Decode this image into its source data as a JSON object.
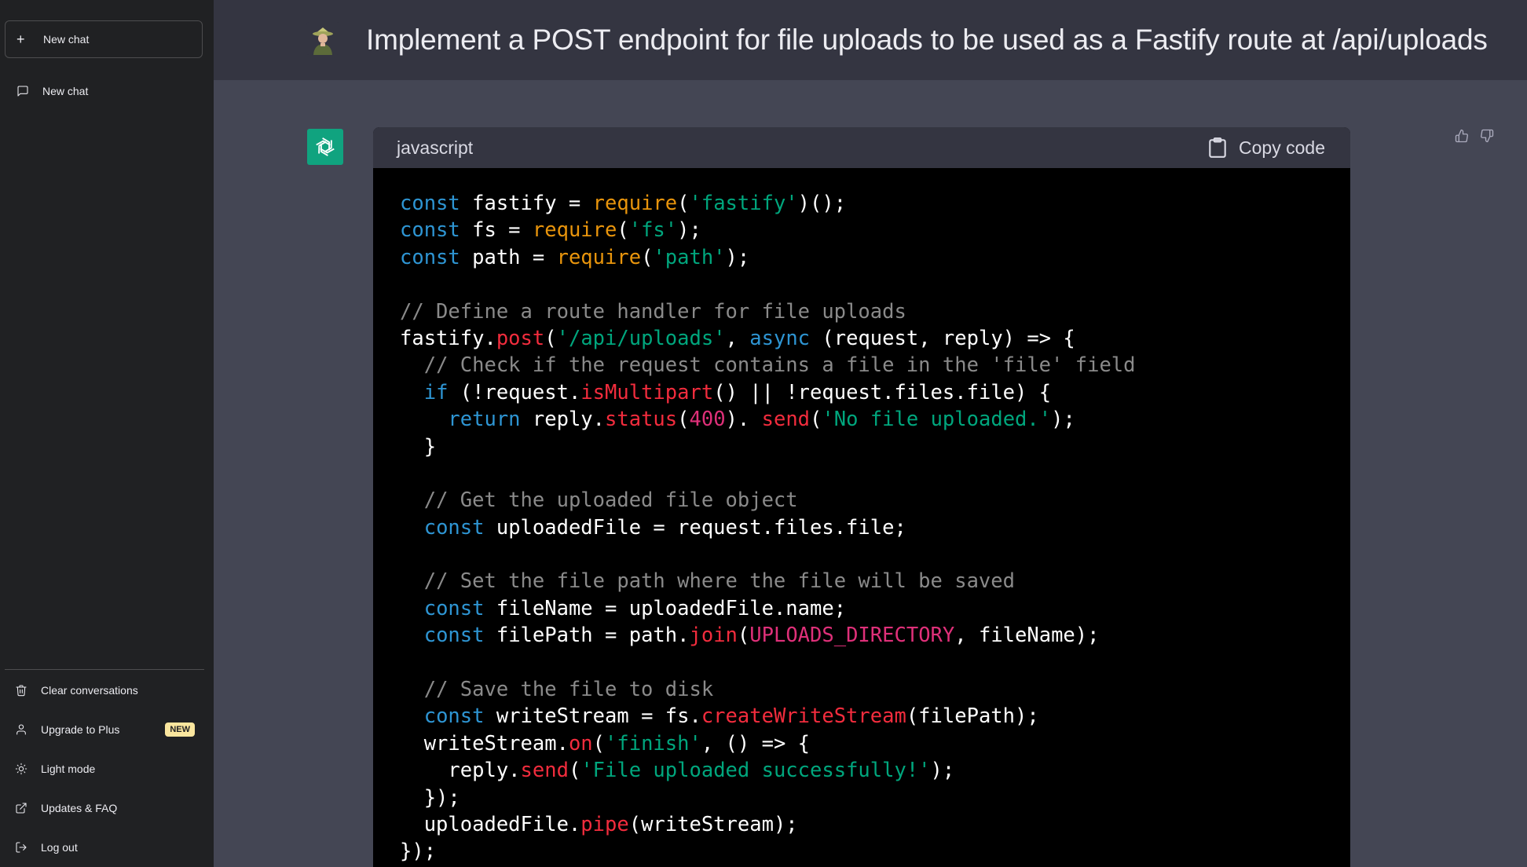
{
  "sidebar": {
    "new_chat_button": "New chat",
    "history": [
      {
        "label": "New chat"
      }
    ],
    "bottom_menu": [
      {
        "label": "Clear conversations",
        "icon": "trash-icon"
      },
      {
        "label": "Upgrade to Plus",
        "icon": "user-icon",
        "badge": "NEW"
      },
      {
        "label": "Light mode",
        "icon": "sun-icon"
      },
      {
        "label": "Updates & FAQ",
        "icon": "external-link-icon"
      },
      {
        "label": "Log out",
        "icon": "logout-icon"
      }
    ]
  },
  "conversation": {
    "user_prompt": "Implement a POST endpoint for file uploads to be used as a Fastify route at /api/uploads",
    "code_block": {
      "language": "javascript",
      "copy_label": "Copy code",
      "lines": [
        [
          [
            "kw",
            "const"
          ],
          [
            "pl",
            " fastify = "
          ],
          [
            "req",
            "require"
          ],
          [
            "pl",
            "("
          ],
          [
            "str",
            "'fastify'"
          ],
          [
            "pl",
            ")();"
          ]
        ],
        [
          [
            "kw",
            "const"
          ],
          [
            "pl",
            " fs = "
          ],
          [
            "req",
            "require"
          ],
          [
            "pl",
            "("
          ],
          [
            "str",
            "'fs'"
          ],
          [
            "pl",
            ");"
          ]
        ],
        [
          [
            "kw",
            "const"
          ],
          [
            "pl",
            " path = "
          ],
          [
            "req",
            "require"
          ],
          [
            "pl",
            "("
          ],
          [
            "str",
            "'path'"
          ],
          [
            "pl",
            ");"
          ]
        ],
        [],
        [
          [
            "cm",
            "// Define a route handler for file uploads"
          ]
        ],
        [
          [
            "pl",
            "fastify."
          ],
          [
            "fn",
            "post"
          ],
          [
            "pl",
            "("
          ],
          [
            "str",
            "'/api/uploads'"
          ],
          [
            "pl",
            ", "
          ],
          [
            "kw",
            "async"
          ],
          [
            "pl",
            " (request, reply) => {"
          ]
        ],
        [
          [
            "pl",
            "  "
          ],
          [
            "cm",
            "// Check if the request contains a file in the 'file' field"
          ]
        ],
        [
          [
            "pl",
            "  "
          ],
          [
            "kw",
            "if"
          ],
          [
            "pl",
            " (!request."
          ],
          [
            "fn",
            "isMultipart"
          ],
          [
            "pl",
            "() || !request.files.file) {"
          ]
        ],
        [
          [
            "pl",
            "    "
          ],
          [
            "kw",
            "return"
          ],
          [
            "pl",
            " reply."
          ],
          [
            "fn",
            "status"
          ],
          [
            "pl",
            "("
          ],
          [
            "num",
            "400"
          ],
          [
            "pl",
            "). "
          ],
          [
            "fn",
            "send"
          ],
          [
            "pl",
            "("
          ],
          [
            "str",
            "'No file uploaded.'"
          ],
          [
            "pl",
            ");"
          ]
        ],
        [
          [
            "pl",
            "  }"
          ]
        ],
        [],
        [
          [
            "pl",
            "  "
          ],
          [
            "cm",
            "// Get the uploaded file object"
          ]
        ],
        [
          [
            "pl",
            "  "
          ],
          [
            "kw",
            "const"
          ],
          [
            "pl",
            " uploadedFile = request.files.file;"
          ]
        ],
        [],
        [
          [
            "pl",
            "  "
          ],
          [
            "cm",
            "// Set the file path where the file will be saved"
          ]
        ],
        [
          [
            "pl",
            "  "
          ],
          [
            "kw",
            "const"
          ],
          [
            "pl",
            " fileName = uploadedFile.name;"
          ]
        ],
        [
          [
            "pl",
            "  "
          ],
          [
            "kw",
            "const"
          ],
          [
            "pl",
            " filePath = path."
          ],
          [
            "fn",
            "join"
          ],
          [
            "pl",
            "("
          ],
          [
            "num",
            "UPLOADS_DIRECTORY"
          ],
          [
            "pl",
            ", fileName);"
          ]
        ],
        [],
        [
          [
            "pl",
            "  "
          ],
          [
            "cm",
            "// Save the file to disk"
          ]
        ],
        [
          [
            "pl",
            "  "
          ],
          [
            "kw",
            "const"
          ],
          [
            "pl",
            " writeStream = fs."
          ],
          [
            "fn",
            "createWriteStream"
          ],
          [
            "pl",
            "(filePath);"
          ]
        ],
        [
          [
            "pl",
            "  writeStream."
          ],
          [
            "fn",
            "on"
          ],
          [
            "pl",
            "("
          ],
          [
            "str",
            "'finish'"
          ],
          [
            "pl",
            ", () => {"
          ]
        ],
        [
          [
            "pl",
            "    reply."
          ],
          [
            "fn",
            "send"
          ],
          [
            "pl",
            "("
          ],
          [
            "str",
            "'File uploaded successfully!'"
          ],
          [
            "pl",
            ");"
          ]
        ],
        [
          [
            "pl",
            "  });"
          ]
        ],
        [
          [
            "pl",
            "  uploadedFile."
          ],
          [
            "fn",
            "pipe"
          ],
          [
            "pl",
            "(writeStream);"
          ]
        ],
        [
          [
            "pl",
            "});"
          ]
        ]
      ]
    }
  },
  "colors": {
    "sidebar_bg": "#202123",
    "user_row_bg": "#343541",
    "assistant_row_bg": "#444654",
    "assistant_avatar_bg": "#10a37f",
    "keyword": "#2e95d3",
    "function": "#f22c3d",
    "require": "#e9950c",
    "string": "#00a67d",
    "comment": "#8a8a8a",
    "number": "#df3079"
  },
  "icons": {
    "assistant_avatar": "openai-logo-icon",
    "feedback": [
      "thumbs-up-icon",
      "thumbs-down-icon"
    ]
  }
}
